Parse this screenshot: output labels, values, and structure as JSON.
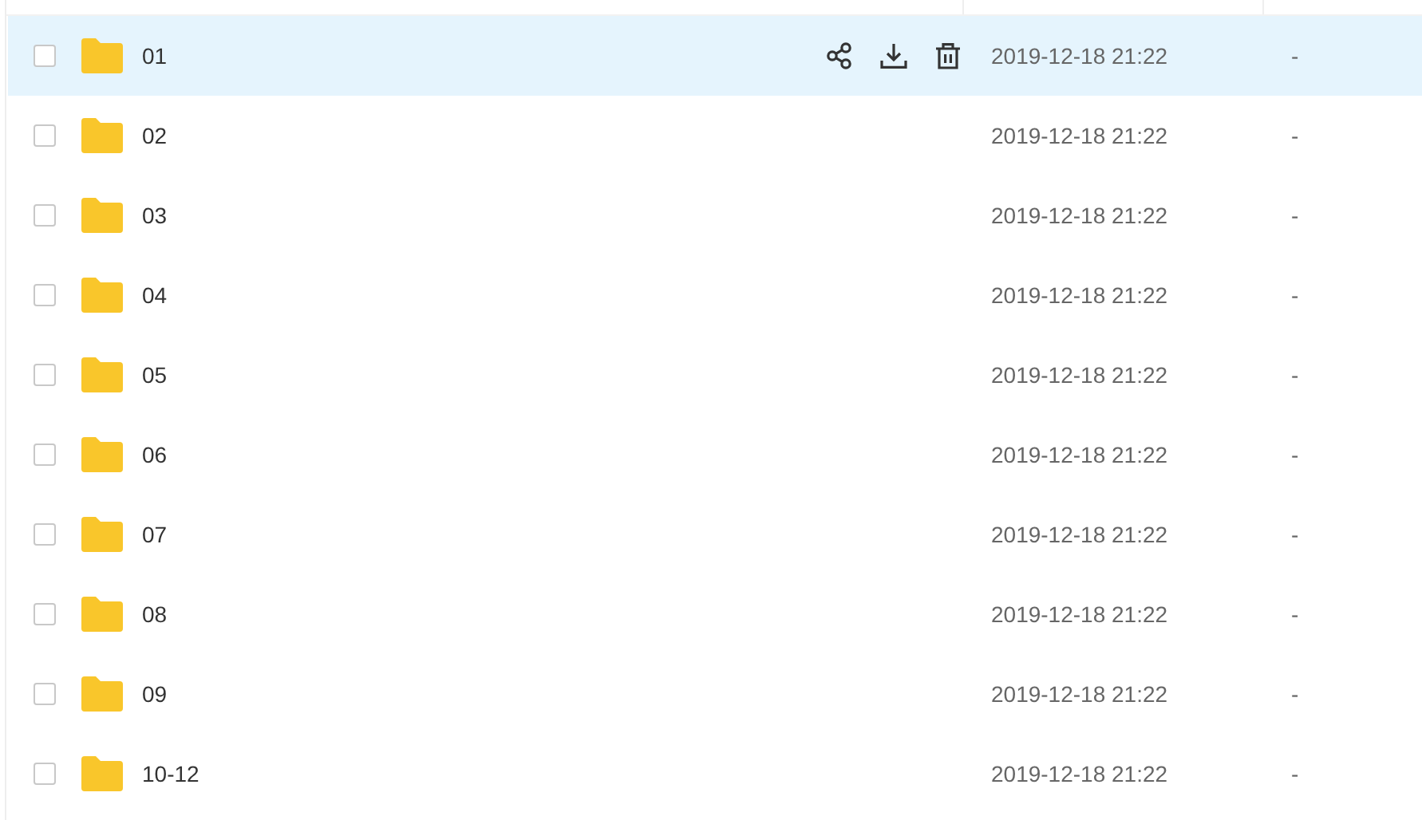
{
  "rows": [
    {
      "name": "01",
      "modified": "2019-12-18 21:22",
      "size": "-",
      "checked": false,
      "highlighted": true
    },
    {
      "name": "02",
      "modified": "2019-12-18 21:22",
      "size": "-",
      "checked": false,
      "highlighted": false
    },
    {
      "name": "03",
      "modified": "2019-12-18 21:22",
      "size": "-",
      "checked": false,
      "highlighted": false
    },
    {
      "name": "04",
      "modified": "2019-12-18 21:22",
      "size": "-",
      "checked": false,
      "highlighted": false
    },
    {
      "name": "05",
      "modified": "2019-12-18 21:22",
      "size": "-",
      "checked": false,
      "highlighted": false
    },
    {
      "name": "06",
      "modified": "2019-12-18 21:22",
      "size": "-",
      "checked": false,
      "highlighted": false
    },
    {
      "name": "07",
      "modified": "2019-12-18 21:22",
      "size": "-",
      "checked": false,
      "highlighted": false
    },
    {
      "name": "08",
      "modified": "2019-12-18 21:22",
      "size": "-",
      "checked": false,
      "highlighted": false
    },
    {
      "name": "09",
      "modified": "2019-12-18 21:22",
      "size": "-",
      "checked": false,
      "highlighted": false
    },
    {
      "name": "10-12",
      "modified": "2019-12-18 21:22",
      "size": "-",
      "checked": false,
      "highlighted": false
    }
  ]
}
